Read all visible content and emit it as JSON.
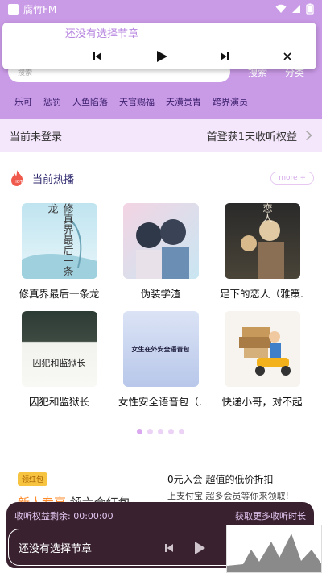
{
  "status_bar": {
    "app_name": "腐竹FM"
  },
  "search": {
    "placeholder": "搜索",
    "search_label": "搜索",
    "category_label": "分类"
  },
  "tags": [
    "乐可",
    "惩罚",
    "人鱼陷落",
    "天官赐福",
    "天潢贵胄",
    "跨界演员"
  ],
  "notification": {
    "title": "还没有选择节章"
  },
  "login_bar": {
    "status": "当前未登录",
    "promo": "首登获1天收听权益"
  },
  "hot": {
    "title": "当前热播",
    "more_label": "more +",
    "items": [
      {
        "title": "修真界最后一条龙",
        "cover_text": "修真界最后一条龙"
      },
      {
        "title": "伪装学渣",
        "cover_text": ""
      },
      {
        "title": "足下的恋人（雅策...",
        "cover_text": "恋人"
      },
      {
        "title": "囚犯和监狱长",
        "cover_text": "囚犯和监狱长"
      },
      {
        "title": "女性安全语音包（...",
        "cover_text": "女生在外安全语音包"
      },
      {
        "title": "快递小哥，对不起",
        "cover_text": ""
      }
    ],
    "carousel_pages": 5,
    "carousel_active": 0
  },
  "promo": {
    "badge": "领红包",
    "left_text_accent": "新人专享",
    "left_text": "领六合红包",
    "right_line1": "0元入会 超值的低价折扣",
    "right_line2": "上支付宝 超多会员等你来领取!"
  },
  "player": {
    "quota_label": "收听权益剩余: 00:00:00",
    "get_more": "获取更多收听时长",
    "now_playing": "还没有选择节章"
  },
  "colors": {
    "header_bg": "#c99ae6",
    "login_bg": "#f4e6fb",
    "player_bg": "#3a2130",
    "accent_text": "#d5a9ea"
  }
}
